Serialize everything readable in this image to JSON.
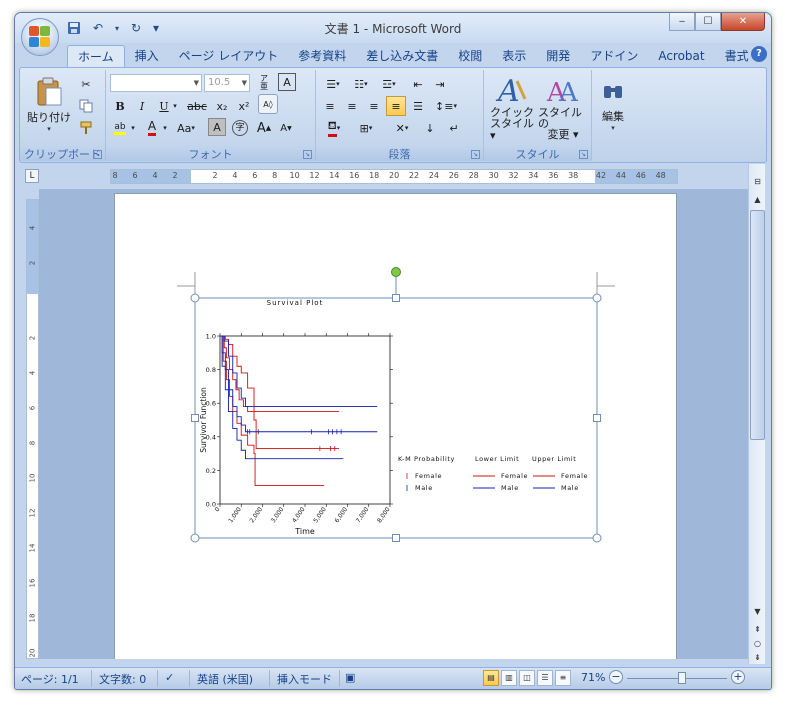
{
  "window": {
    "title": "文書 1 - Microsoft Word",
    "minimize": "‒",
    "maximize": "☐",
    "close": "✕"
  },
  "qat": {
    "save": "💾",
    "undo": "↶",
    "redo": "↻",
    "customize": "▾"
  },
  "tabs": [
    "ホーム",
    "挿入",
    "ページ レイアウト",
    "参考資料",
    "差し込み文書",
    "校閲",
    "表示",
    "開発",
    "アドイン",
    "Acrobat",
    "書式"
  ],
  "help": "?",
  "ribbon": {
    "clipboard": {
      "paste": "貼り付け",
      "label": "クリップボード"
    },
    "font": {
      "font_name": "",
      "font_size": "10.5",
      "label": "フォント",
      "bold": "B",
      "italic": "I",
      "underline": "U",
      "strike": "abc",
      "subscript": "x₂",
      "superscript": "x²",
      "grow": "A",
      "shrink": "A",
      "case": "Aa"
    },
    "paragraph": {
      "label": "段落"
    },
    "styles": {
      "quick_style_line1": "クイック",
      "quick_style_line2": "スタイル",
      "change_style_line1": "スタイルの",
      "change_style_line2": "変更",
      "label": "スタイル"
    },
    "editing": {
      "label": "編集"
    }
  },
  "ruler": {
    "h_numbers": [
      "8",
      "6",
      "4",
      "2",
      "2",
      "4",
      "6",
      "8",
      "10",
      "12",
      "14",
      "16",
      "18",
      "20",
      "22",
      "24",
      "26",
      "28",
      "30",
      "32",
      "34",
      "36",
      "38",
      "42",
      "44",
      "46",
      "48"
    ],
    "v_numbers": [
      "4",
      "2",
      "2",
      "4",
      "6",
      "8",
      "10",
      "12",
      "14",
      "16",
      "18",
      "20"
    ]
  },
  "statusbar": {
    "page": "ページ: 1/1",
    "words": "文字数: 0",
    "language": "英語 (米国)",
    "mode": "挿入モード",
    "zoom": "71%",
    "zoom_level": 0.55
  },
  "chart_data": {
    "type": "line",
    "title": "Survival Plot",
    "xlabel": "Time",
    "ylabel": "Survivor Function",
    "xlim": [
      0,
      8000
    ],
    "ylim": [
      0,
      1.0
    ],
    "x_ticks": [
      "0",
      "1,000",
      "2,000",
      "3,000",
      "4,000",
      "5,000",
      "6,000",
      "7,000",
      "8,000"
    ],
    "y_ticks": [
      "0.0",
      "0.2",
      "0.4",
      "0.6",
      "0.8",
      "1.0"
    ],
    "legend": {
      "headers": [
        "K-M Probability",
        "Lower Limit",
        "Upper Limit"
      ],
      "rows": [
        {
          "name": "Female",
          "color": "#d01010"
        },
        {
          "name": "Male",
          "color": "#1020b0"
        }
      ]
    },
    "series": [
      {
        "name": "Female",
        "role": "K-M Probability",
        "color": "#d01010",
        "x": [
          0,
          200,
          300,
          450,
          600,
          750,
          900,
          1100,
          1300,
          1600,
          1700,
          5600
        ],
        "y": [
          1.0,
          0.93,
          0.87,
          0.8,
          0.74,
          0.68,
          0.62,
          0.58,
          0.55,
          0.5,
          0.33,
          0.33
        ]
      },
      {
        "name": "Female",
        "role": "Lower Limit",
        "color": "#d01010",
        "x": [
          0,
          150,
          300,
          450,
          600,
          800,
          1000,
          1300,
          1600,
          1650,
          4900
        ],
        "y": [
          1.0,
          0.85,
          0.74,
          0.64,
          0.55,
          0.48,
          0.41,
          0.35,
          0.3,
          0.11,
          0.11
        ]
      },
      {
        "name": "Female",
        "role": "Upper Limit",
        "color": "#d01010",
        "x": [
          0,
          250,
          400,
          600,
          800,
          1000,
          1300,
          1600,
          1700,
          5600
        ],
        "y": [
          1.0,
          0.98,
          0.95,
          0.88,
          0.82,
          0.78,
          0.69,
          0.55,
          0.55,
          0.55
        ]
      },
      {
        "name": "Male",
        "role": "K-M Probability",
        "color": "#1020b0",
        "x": [
          0,
          100,
          250,
          400,
          600,
          800,
          1000,
          1200,
          7400
        ],
        "y": [
          1.0,
          0.9,
          0.8,
          0.68,
          0.58,
          0.52,
          0.47,
          0.43,
          0.43
        ]
      },
      {
        "name": "Male",
        "role": "Lower Limit",
        "color": "#1020b0",
        "x": [
          0,
          100,
          250,
          400,
          600,
          800,
          1000,
          1200,
          5800
        ],
        "y": [
          1.0,
          0.82,
          0.68,
          0.55,
          0.45,
          0.38,
          0.32,
          0.27,
          0.27
        ]
      },
      {
        "name": "Male",
        "role": "Upper Limit",
        "color": "#1020b0",
        "x": [
          0,
          200,
          400,
          600,
          800,
          1000,
          1200,
          7400
        ],
        "y": [
          1.0,
          0.97,
          0.88,
          0.78,
          0.69,
          0.63,
          0.58,
          0.58
        ]
      }
    ],
    "censor_ticks": [
      {
        "color": "#d01010",
        "x": [
          4700,
          5200,
          5400
        ],
        "y": 0.33
      },
      {
        "color": "#1020b0",
        "x": [
          1300,
          1400,
          1800,
          4300,
          5100,
          5300,
          5500,
          5700
        ],
        "y": 0.43
      }
    ]
  }
}
